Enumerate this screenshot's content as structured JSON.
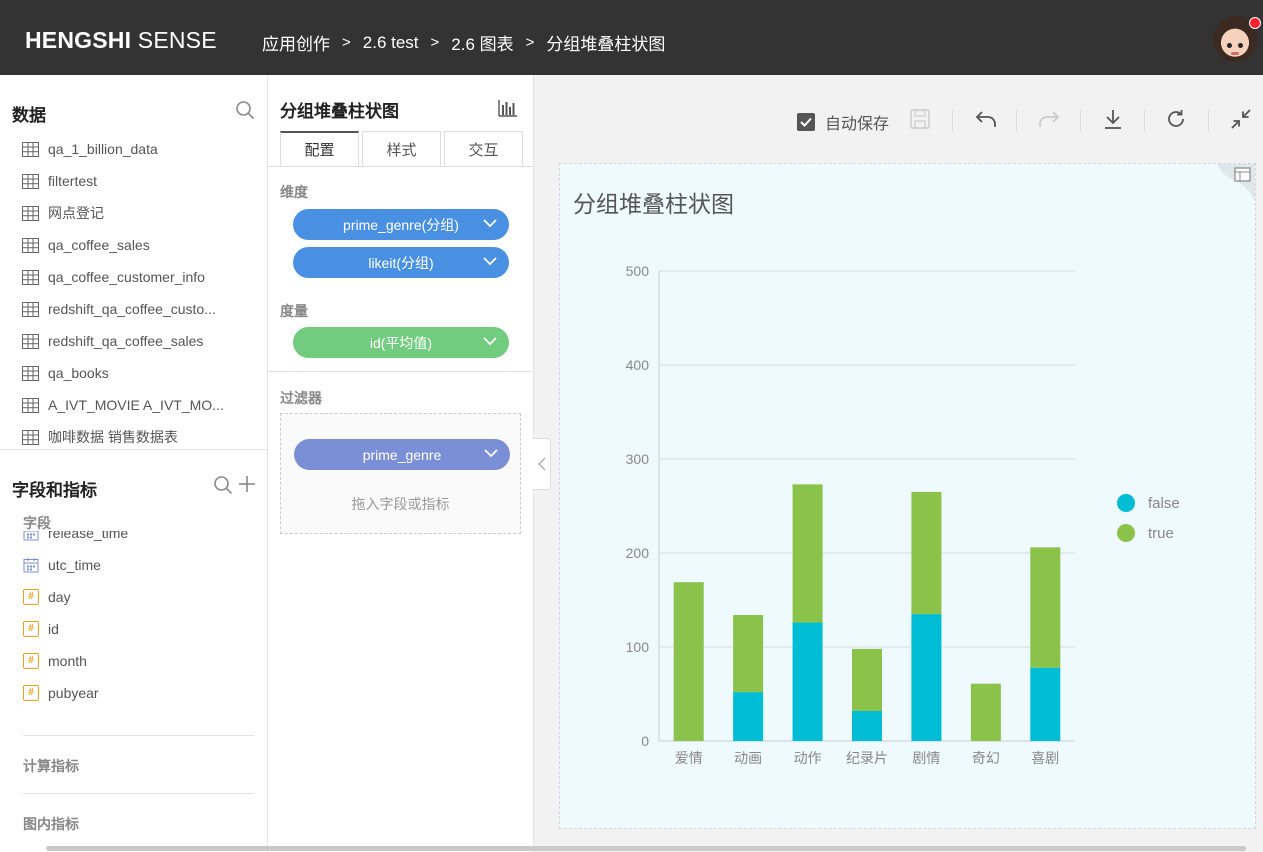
{
  "header": {
    "brand_bold": "HENGSHI",
    "brand_light": " SENSE",
    "breadcrumbs": [
      "应用创作",
      "2.6 test",
      "2.6 图表",
      "分组堆叠柱状图"
    ],
    "separator": ">"
  },
  "data_panel": {
    "title": "数据",
    "tables": [
      "qa_1_billion_data",
      "filtertest",
      "网点登记",
      "qa_coffee_sales",
      "qa_coffee_customer_info",
      "redshift_qa_coffee_custo...",
      "redshift_qa_coffee_sales",
      "qa_books",
      "A_IVT_MOVIE A_IVT_MO...",
      "咖啡数据 销售数据表"
    ]
  },
  "fields_panel": {
    "title": "字段和指标",
    "fields_label": "字段",
    "fields": [
      {
        "name": "release_time",
        "type": "date"
      },
      {
        "name": "utc_time",
        "type": "date"
      },
      {
        "name": "day",
        "type": "number"
      },
      {
        "name": "id",
        "type": "number"
      },
      {
        "name": "month",
        "type": "number"
      },
      {
        "name": "pubyear",
        "type": "number"
      }
    ],
    "calc_metrics_label": "计算指标",
    "chart_metrics_label": "图内指标"
  },
  "config_panel": {
    "title": "分组堆叠柱状图",
    "tabs": [
      "配置",
      "样式",
      "交互"
    ],
    "active_tab": "配置",
    "dimension_label": "维度",
    "dimensions": [
      "prime_genre(分组)",
      "likeit(分组)"
    ],
    "measure_label": "度量",
    "measures": [
      "id(平均值)"
    ],
    "filter_label": "过滤器",
    "filters": [
      "prime_genre"
    ],
    "filter_hint": "拖入字段或指标"
  },
  "toolbar": {
    "autosave_label": "自动保存",
    "autosave_checked": true
  },
  "colors": {
    "false": "#00bcd4",
    "true": "#8bc34a",
    "pill_blue": "#4a90e2",
    "pill_green": "#72cc7f",
    "pill_purple": "#7b8fd6"
  },
  "chart_data": {
    "type": "bar",
    "stacked": true,
    "title": "分组堆叠柱状图",
    "categories": [
      "爱情",
      "动画",
      "动作",
      "纪录片",
      "剧情",
      "奇幻",
      "喜剧"
    ],
    "series": [
      {
        "name": "false",
        "values": [
          0,
          52,
          126,
          32,
          135,
          0,
          78
        ]
      },
      {
        "name": "true",
        "values": [
          169,
          82,
          147,
          66,
          130,
          61,
          128
        ]
      }
    ],
    "ylim": [
      0,
      500
    ],
    "yticks": [
      0,
      100,
      200,
      300,
      400,
      500
    ],
    "grid": true,
    "legend": "right"
  }
}
